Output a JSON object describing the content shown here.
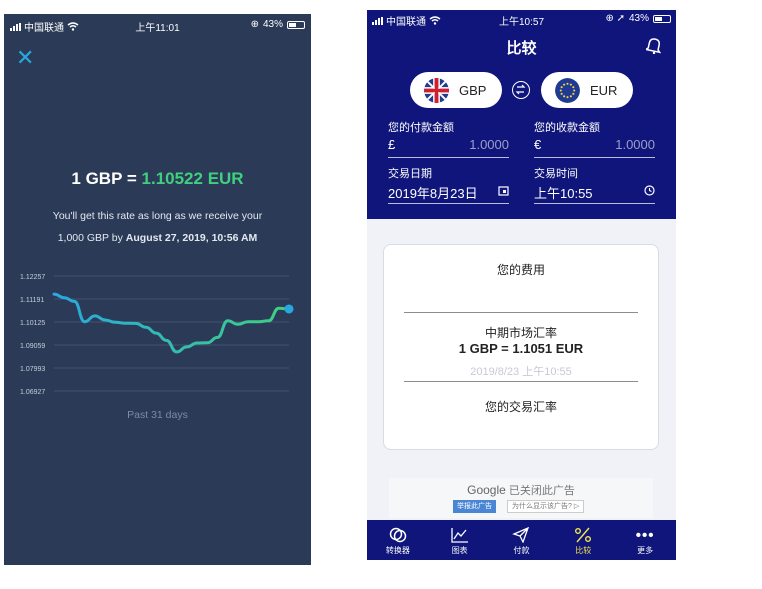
{
  "left_screen": {
    "status": {
      "carrier": "中国联通",
      "time": "上午11:01",
      "battery": "43%"
    },
    "rate_base": "1 GBP =",
    "rate_value": "1.10522 EUR",
    "note_line1": "You'll get this rate as long as we receive your",
    "note_line2_prefix": "1,000 GBP by ",
    "note_line2_bold": "August 27, 2019, 10:56 AM",
    "period_label": "Past 31 days",
    "colors": {
      "background": "#2b3b57",
      "accent": "#29a8e0",
      "positive": "#3fd07f"
    },
    "chart_data": {
      "type": "line",
      "y_ticks": [
        "1.12257",
        "1.11191",
        "1.10125",
        "1.09059",
        "1.07993",
        "1.06927"
      ],
      "ylim": [
        1.06927,
        1.12257
      ],
      "x_days": 31,
      "values": [
        1.1142,
        1.1125,
        1.1108,
        1.1014,
        1.1041,
        1.1022,
        1.1011,
        1.1007,
        1.1006,
        1.0988,
        1.0961,
        1.0927,
        1.0874,
        1.0897,
        1.0915,
        1.0916,
        1.0941,
        1.1018,
        1.1002,
        1.1014,
        1.1014,
        1.1018,
        1.1076,
        1.1073
      ],
      "grid": true,
      "line_colors": [
        "#29a8e0",
        "#3fd07f"
      ]
    }
  },
  "right_screen": {
    "status": {
      "carrier": "中国联通",
      "time": "上午10:57",
      "battery": "43%"
    },
    "title": "比较",
    "from_currency": "GBP",
    "to_currency": "EUR",
    "pay_label": "您的付款金额",
    "pay_symbol": "£",
    "pay_placeholder": "1.0000",
    "receive_label": "您的收款金额",
    "receive_symbol": "€",
    "receive_placeholder": "1.0000",
    "date_label": "交易日期",
    "date_value": "2019年8月23日",
    "time_label": "交易时间",
    "time_value": "上午10:55",
    "card": {
      "fee_title": "您的费用",
      "mid_title": "中期市场汇率",
      "mid_rate": "1 GBP = 1.1051 EUR",
      "mid_date": "2019/8/23 上午10:55",
      "your_rate": "您的交易汇率"
    },
    "ad": {
      "google": "Google",
      "closed": "已关闭此广告",
      "report": "举报此广告",
      "why": "为什么显示该广告?"
    },
    "tabs": [
      {
        "label": "转换器",
        "icon": "coins-icon"
      },
      {
        "label": "图表",
        "icon": "chart-icon"
      },
      {
        "label": "付款",
        "icon": "send-icon"
      },
      {
        "label": "比较",
        "icon": "percent-icon"
      },
      {
        "label": "更多",
        "icon": "more-icon"
      }
    ],
    "active_tab": 3,
    "colors": {
      "header": "#0f157a",
      "active_tab": "#f4e84f"
    }
  }
}
